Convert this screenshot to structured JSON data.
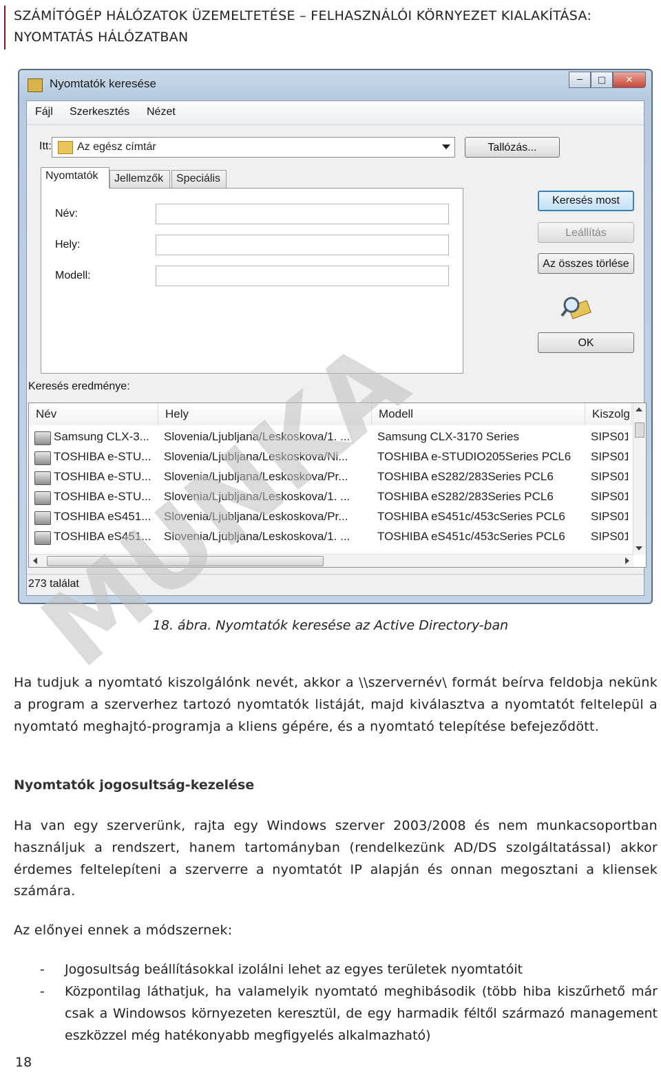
{
  "header": {
    "line1": "SZÁMÍTÓGÉP HÁLÓZATOK ÜZEMELTETÉSE – FELHASZNÁLÓI KÖRNYEZET KIALAKÍTÁSA:",
    "line2": "NYOMTATÁS HÁLÓZATBAN"
  },
  "window": {
    "title": "Nyomtatók keresése",
    "menu": [
      "Fájl",
      "Szerkesztés",
      "Nézet"
    ],
    "in_label": "Itt:",
    "in_value": "Az egész címtár",
    "browse": "Tallózás...",
    "tabs": [
      "Nyomtatók",
      "Jellemzők",
      "Speciális"
    ],
    "fields": [
      "Név:",
      "Hely:",
      "Modell:"
    ],
    "buttons": {
      "search": "Keresés most",
      "stop": "Leállítás",
      "clear": "Az összes törlése",
      "ok": "OK"
    },
    "results_label": "Keresés eredménye:",
    "columns": [
      "Név",
      "Hely",
      "Modell",
      "Kiszolg"
    ],
    "rows": [
      [
        "Samsung CLX-3...",
        "Slovenia/Ljubljana/Leskoskova/1. ...",
        "Samsung CLX-3170 Series",
        "SIPS01"
      ],
      [
        "TOSHIBA e-STU...",
        "Slovenia/Ljubljana/Leskoskova/Ni...",
        "TOSHIBA e-STUDIO205Series PCL6",
        "SIPS01"
      ],
      [
        "TOSHIBA e-STU...",
        "Slovenia/Ljubljana/Leskoskova/Pr...",
        "TOSHIBA eS282/283Series PCL6",
        "SIPS01"
      ],
      [
        "TOSHIBA e-STU...",
        "Slovenia/Ljubljana/Leskoskova/1. ...",
        "TOSHIBA eS282/283Series PCL6",
        "SIPS01"
      ],
      [
        "TOSHIBA eS451...",
        "Slovenia/Ljubljana/Leskoskova/Pr...",
        "TOSHIBA eS451c/453cSeries PCL6",
        "SIPS01"
      ],
      [
        "TOSHIBA eS451...",
        "Slovenia/Ljubljana/Leskoskova/1. ...",
        "TOSHIBA eS451c/453cSeries PCL6",
        "SIPS01"
      ]
    ],
    "status": "273 találat"
  },
  "caption": "18. ábra. Nyomtatók keresése az Active Directory-ban",
  "para1": "Ha tudjuk a nyomtató kiszolgálónk nevét, akkor a \\\\szervernév\\ formát beírva feldobja nekünk a program a szerverhez tartozó nyomtatók listáját, majd kiválasztva a nyomtatót feltelepül a nyomtató meghajtó-programja a kliens gépére, és a nyomtató telepítése befejeződött.",
  "heading": "Nyomtatók jogosultság-kezelése",
  "para2": "Ha van egy szerverünk, rajta egy Windows szerver 2003/2008 és nem munkacsoportban használjuk a rendszert, hanem tartományban (rendelkezünk AD/DS szolgáltatással) akkor érdemes feltelepíteni a szerverre a nyomtatót IP alapján és onnan megosztani a kliensek számára.",
  "para3": "Az előnyei ennek a módszernek:",
  "bullets": [
    {
      "dash": "-",
      "text": "Jogosultság beállításokkal izolálni lehet az egyes területek nyomtatóit"
    },
    {
      "dash": "-",
      "text": "Központilag láthatjuk, ha valamelyik nyomtató meghibásodik (több hiba kiszűrhető már csak a Windowsos környezeten keresztül, de egy harmadik féltől származó management eszközzel még hatékonyabb megfigyelés alkalmazható)"
    }
  ],
  "page_number": "18",
  "watermark": "MUNKA"
}
